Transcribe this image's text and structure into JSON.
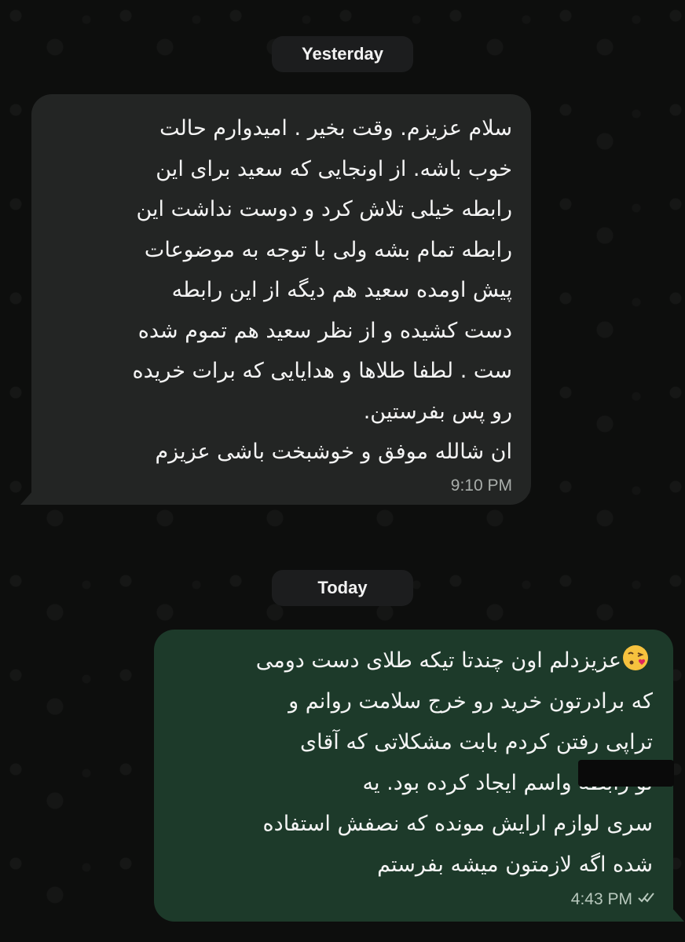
{
  "date_separators": {
    "yesterday": "Yesterday",
    "today": "Today"
  },
  "messages": [
    {
      "direction": "incoming",
      "text": "سلام عزیزم. وقت بخیر . امیدوارم حالت\nخوب باشه.  از اونجایی که  سعید برای این\nرابطه خیلی تلاش کرد و دوست نداشت این\nرابطه تمام بشه ولی با توجه به موضوعات\nپیش اومده سعید هم دیگه از این رابطه\nدست کشیده و از نظر سعید هم تموم شده\nست . لطفا طلاها و هدایایی که برات خریده\nرو پس بفرستین.\nان شالله موفق و خوشبخت باشی عزیزم",
      "time": "9:10 PM",
      "bubble_color": "#232524"
    },
    {
      "direction": "outgoing",
      "text": "عزیزدلم اون چندتا تیکه طلای دست دومی\nکه برادرتون خرید رو خرج  سلامت روانم و\nتراپی رفتن کردم بابت مشکلاتی که آقای\nتو رابطه واسم ایجاد کرده بود. یه\nسری لوازم ارایش مونده که نصفش استفاده\nشده اگه لازمتون میشه بفرستم",
      "emoji": "face-blowing-a-kiss-icon",
      "time": "4:43 PM",
      "status": "read-double-check-icon",
      "bubble_color": "#1d3a2a"
    }
  ],
  "colors": {
    "background": "#0d0e0d",
    "date_pill": "#1c1d1e",
    "incoming_bubble": "#232524",
    "outgoing_bubble": "#1d3a2a",
    "timestamp": "#a9aeab"
  }
}
